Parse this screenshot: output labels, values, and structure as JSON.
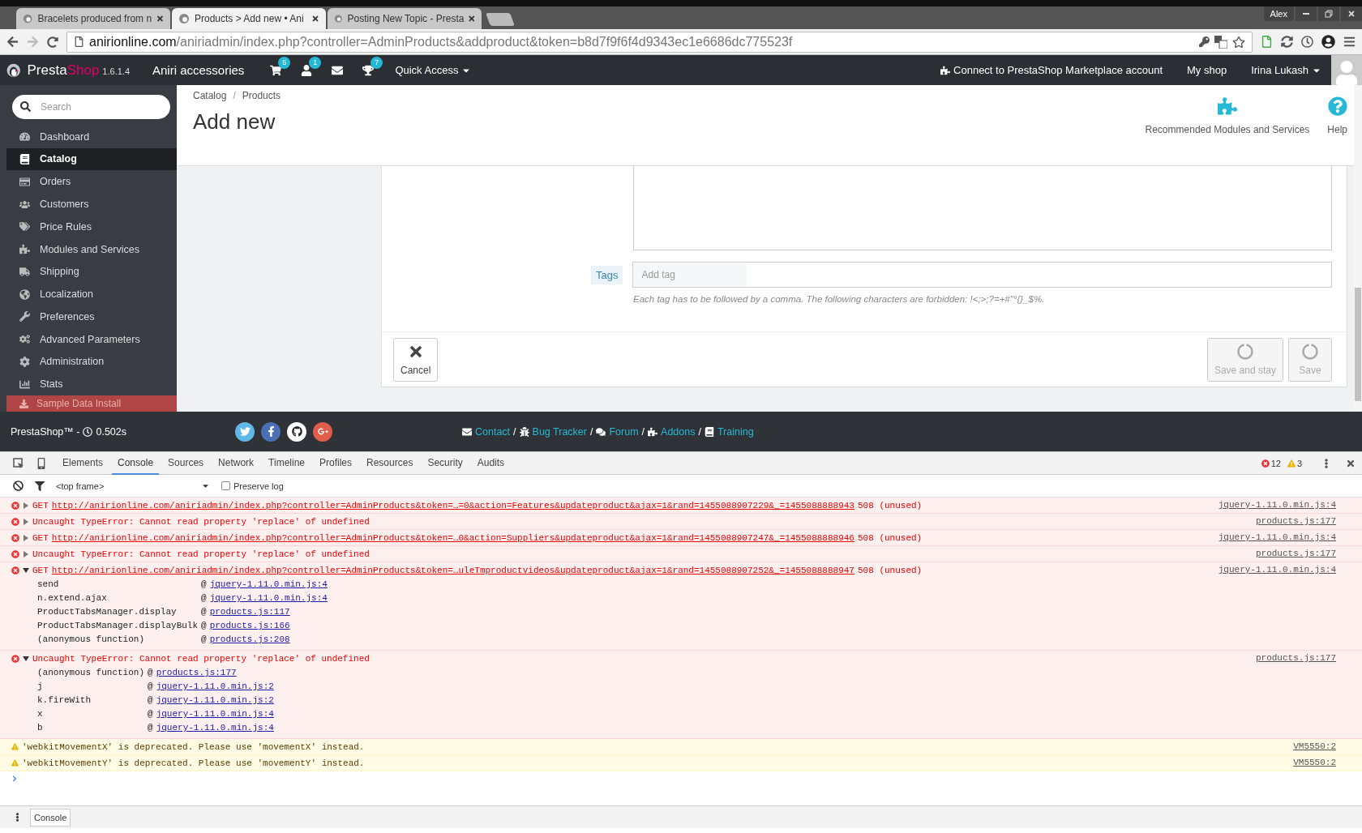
{
  "browser": {
    "tabs": [
      {
        "title": "Bracelets produced from n",
        "selected": false
      },
      {
        "title": "Products > Add new • Ani",
        "selected": true
      },
      {
        "title": "Posting New Topic - Presta",
        "selected": false
      }
    ],
    "profile": "Alex",
    "address": {
      "host": "anirionline.com",
      "path": "/aniriadmin/index.php?controller=AdminProducts&addproduct&token=b8d7f9f6f4d9343ec1e6686dc775523f"
    }
  },
  "header": {
    "brand_first": "Presta",
    "brand_second": "Shop",
    "version": "1.6.1.4",
    "shop": "Aniri accessories",
    "notifications": [
      {
        "kind": "cart",
        "count": "5"
      },
      {
        "kind": "user",
        "count": "1"
      },
      {
        "kind": "mail"
      },
      {
        "kind": "trophy",
        "count": "7"
      }
    ],
    "quick_access": "Quick Access",
    "connect": "Connect to PrestaShop Marketplace account",
    "my_shop": "My shop",
    "user": "Irina Lukash"
  },
  "sidebar": {
    "search_placeholder": "Search",
    "items": [
      {
        "label": "Dashboard",
        "selected": false
      },
      {
        "label": "Catalog",
        "selected": true
      },
      {
        "label": "Orders",
        "selected": false
      },
      {
        "label": "Customers",
        "selected": false
      },
      {
        "label": "Price Rules",
        "selected": false
      },
      {
        "label": "Modules and Services",
        "selected": false
      },
      {
        "label": "Shipping",
        "selected": false
      },
      {
        "label": "Localization",
        "selected": false
      },
      {
        "label": "Preferences",
        "selected": false
      },
      {
        "label": "Advanced Parameters",
        "selected": false
      },
      {
        "label": "Administration",
        "selected": false
      },
      {
        "label": "Stats",
        "selected": false
      }
    ],
    "sample_data": "Sample Data Install"
  },
  "page": {
    "breadcrumb": [
      {
        "label": "Catalog",
        "sep": "/"
      },
      {
        "label": "Products"
      }
    ],
    "title": "Add new",
    "toolbar": [
      {
        "kind": "modules",
        "label": "Recommended Modules and Services"
      },
      {
        "kind": "help",
        "label": "Help"
      }
    ],
    "form": {
      "tags_label": "Tags",
      "tags_placeholder": "Add tag",
      "tags_help": "Each tag has to be followed by a comma. The following characters are forbidden: !<;>;?=+#\"°{}_$%.",
      "buttons": [
        {
          "kind": "cancel",
          "label": "Cancel",
          "disabled": false
        },
        {
          "kind": "loading",
          "label": "Save and stay",
          "disabled": true
        },
        {
          "kind": "loading",
          "label": "Save",
          "disabled": true
        }
      ]
    }
  },
  "footer": {
    "brand": "PrestaShop™ - ",
    "time": "0.502s",
    "social": [
      {
        "kind": "twitter"
      },
      {
        "kind": "facebook"
      },
      {
        "kind": "github"
      },
      {
        "kind": "google"
      }
    ],
    "links": [
      {
        "kind": "contact",
        "label": "Contact",
        "sep": "/"
      },
      {
        "kind": "bug",
        "label": "Bug Tracker",
        "sep": "/"
      },
      {
        "kind": "forum",
        "label": "Forum",
        "sep": "/"
      },
      {
        "kind": "addons",
        "label": "Addons",
        "sep": "/"
      },
      {
        "kind": "training",
        "label": "Training"
      }
    ]
  },
  "devtools": {
    "tabs": [
      {
        "label": "Elements",
        "selected": false
      },
      {
        "label": "Console",
        "selected": true
      },
      {
        "label": "Sources",
        "selected": false
      },
      {
        "label": "Network",
        "selected": false
      },
      {
        "label": "Timeline",
        "selected": false
      },
      {
        "label": "Profiles",
        "selected": false
      },
      {
        "label": "Resources",
        "selected": false
      },
      {
        "label": "Security",
        "selected": false
      },
      {
        "label": "Audits",
        "selected": false
      }
    ],
    "error_count": "12",
    "warning_count": "3",
    "frame": "<top frame>",
    "preserve_log": {
      "label": "Preserve log",
      "checked": false
    },
    "messages": [
      {
        "kind": "error",
        "expanded": false,
        "method": "GET",
        "url": "http://anirionline.com/aniriadmin/index.php?controller=AdminProducts&token=…=0&action=Features&updateproduct&ajax=1&rand=1455088907229&_=1455088888943",
        "status": "508 (unused)",
        "source": "jquery-1.11.0.min.js:4"
      },
      {
        "kind": "error",
        "expanded": false,
        "text": "Uncaught TypeError: Cannot read property 'replace' of undefined",
        "source": "products.js:177"
      },
      {
        "kind": "error",
        "expanded": false,
        "method": "GET",
        "url": "http://anirionline.com/aniriadmin/index.php?controller=AdminProducts&token=…0&action=Suppliers&updateproduct&ajax=1&rand=1455088907247&_=1455088888946",
        "status": "508 (unused)",
        "source": "jquery-1.11.0.min.js:4"
      },
      {
        "kind": "error",
        "expanded": false,
        "text": "Uncaught TypeError: Cannot read property 'replace' of undefined",
        "source": "products.js:177"
      },
      {
        "kind": "error",
        "expanded": true,
        "method": "GET",
        "url": "http://anirionline.com/aniriadmin/index.php?controller=AdminProducts&token=…uleTmproductvideos&updateproduct&ajax=1&rand=1455088907252&_=1455088888947",
        "status": "508 (unused)",
        "source": "jquery-1.11.0.min.js:4",
        "stack": [
          {
            "fn": "send",
            "at": "@",
            "src": "jquery-1.11.0.min.js:4"
          },
          {
            "fn": "n.extend.ajax",
            "at": "@",
            "src": "jquery-1.11.0.min.js:4"
          },
          {
            "fn": "ProductTabsManager.display",
            "at": "@",
            "src": "products.js:117"
          },
          {
            "fn": "ProductTabsManager.displayBulk",
            "at": "@",
            "src": "products.js:166"
          },
          {
            "fn": "(anonymous function)",
            "at": "@",
            "src": "products.js:208"
          }
        ]
      },
      {
        "kind": "error",
        "expanded": true,
        "text": "Uncaught TypeError: Cannot read property 'replace' of undefined",
        "source": "products.js:177",
        "stack": [
          {
            "fn": "(anonymous function)",
            "at": "@",
            "src": "products.js:177"
          },
          {
            "fn": "j",
            "at": "@",
            "src": "jquery-1.11.0.min.js:2"
          },
          {
            "fn": "k.fireWith",
            "at": "@",
            "src": "jquery-1.11.0.min.js:2"
          },
          {
            "fn": "x",
            "at": "@",
            "src": "jquery-1.11.0.min.js:4"
          },
          {
            "fn": "b",
            "at": "@",
            "src": "jquery-1.11.0.min.js:4"
          }
        ]
      },
      {
        "kind": "warning",
        "text": "'webkitMovementX' is deprecated. Please use 'movementX' instead.",
        "source": "VM5550:2"
      },
      {
        "kind": "warning",
        "text": "'webkitMovementY' is deprecated. Please use 'movementY' instead.",
        "source": "VM5550:2"
      }
    ],
    "drawer_tab": "Console"
  }
}
